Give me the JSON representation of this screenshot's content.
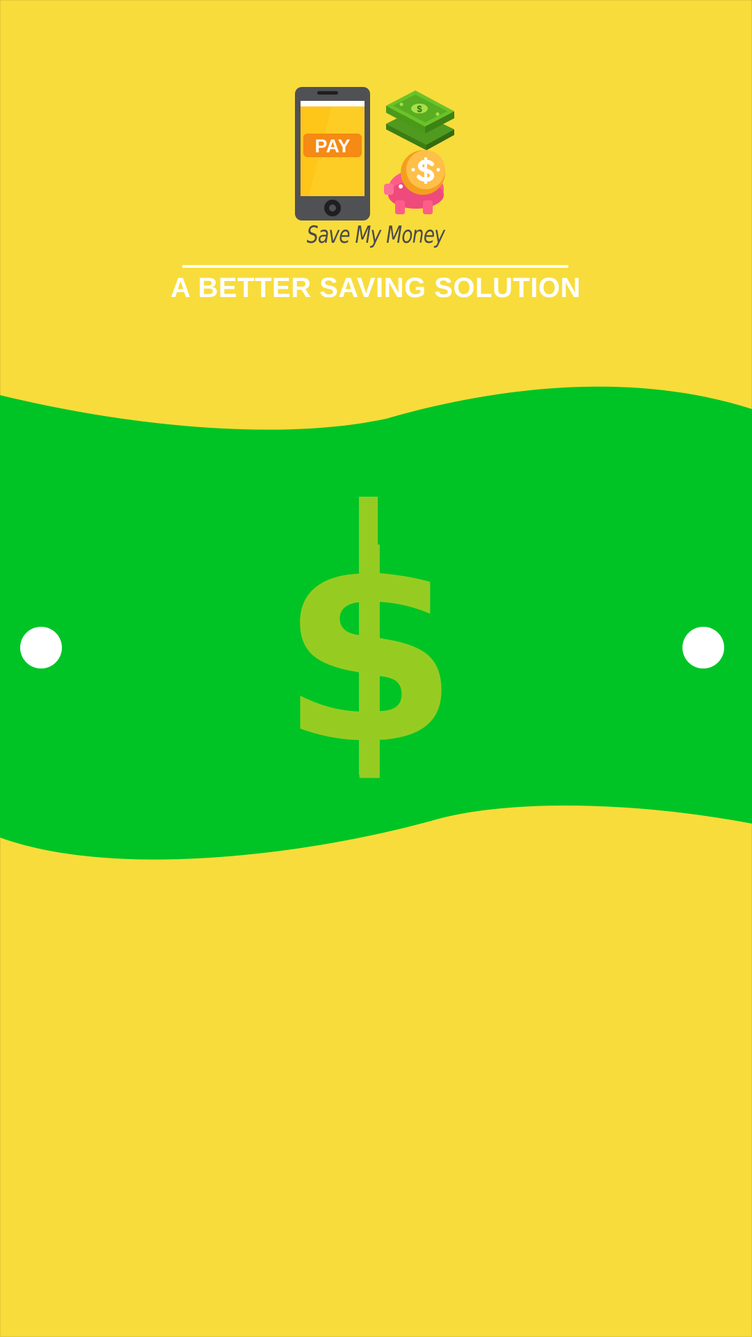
{
  "app": {
    "logo_text": "Save My Money",
    "phone_label": "PAY",
    "tagline": "A BETTER SAVING SOLUTION"
  },
  "icons": {
    "logo_phone": "phone-pay-icon",
    "logo_cash": "cash-stack-icon",
    "logo_piggy": "piggy-bank-icon",
    "banner_symbol": "dollar-sign-icon",
    "banner_holes": "hole-dot-icon"
  },
  "banner": {
    "symbol": "$"
  },
  "colors": {
    "background": "#f8dc3b",
    "banner_green": "#00c425",
    "dollar_green": "#97cc21",
    "text_white": "#ffffff",
    "logo_text": "#4a4a4a"
  }
}
